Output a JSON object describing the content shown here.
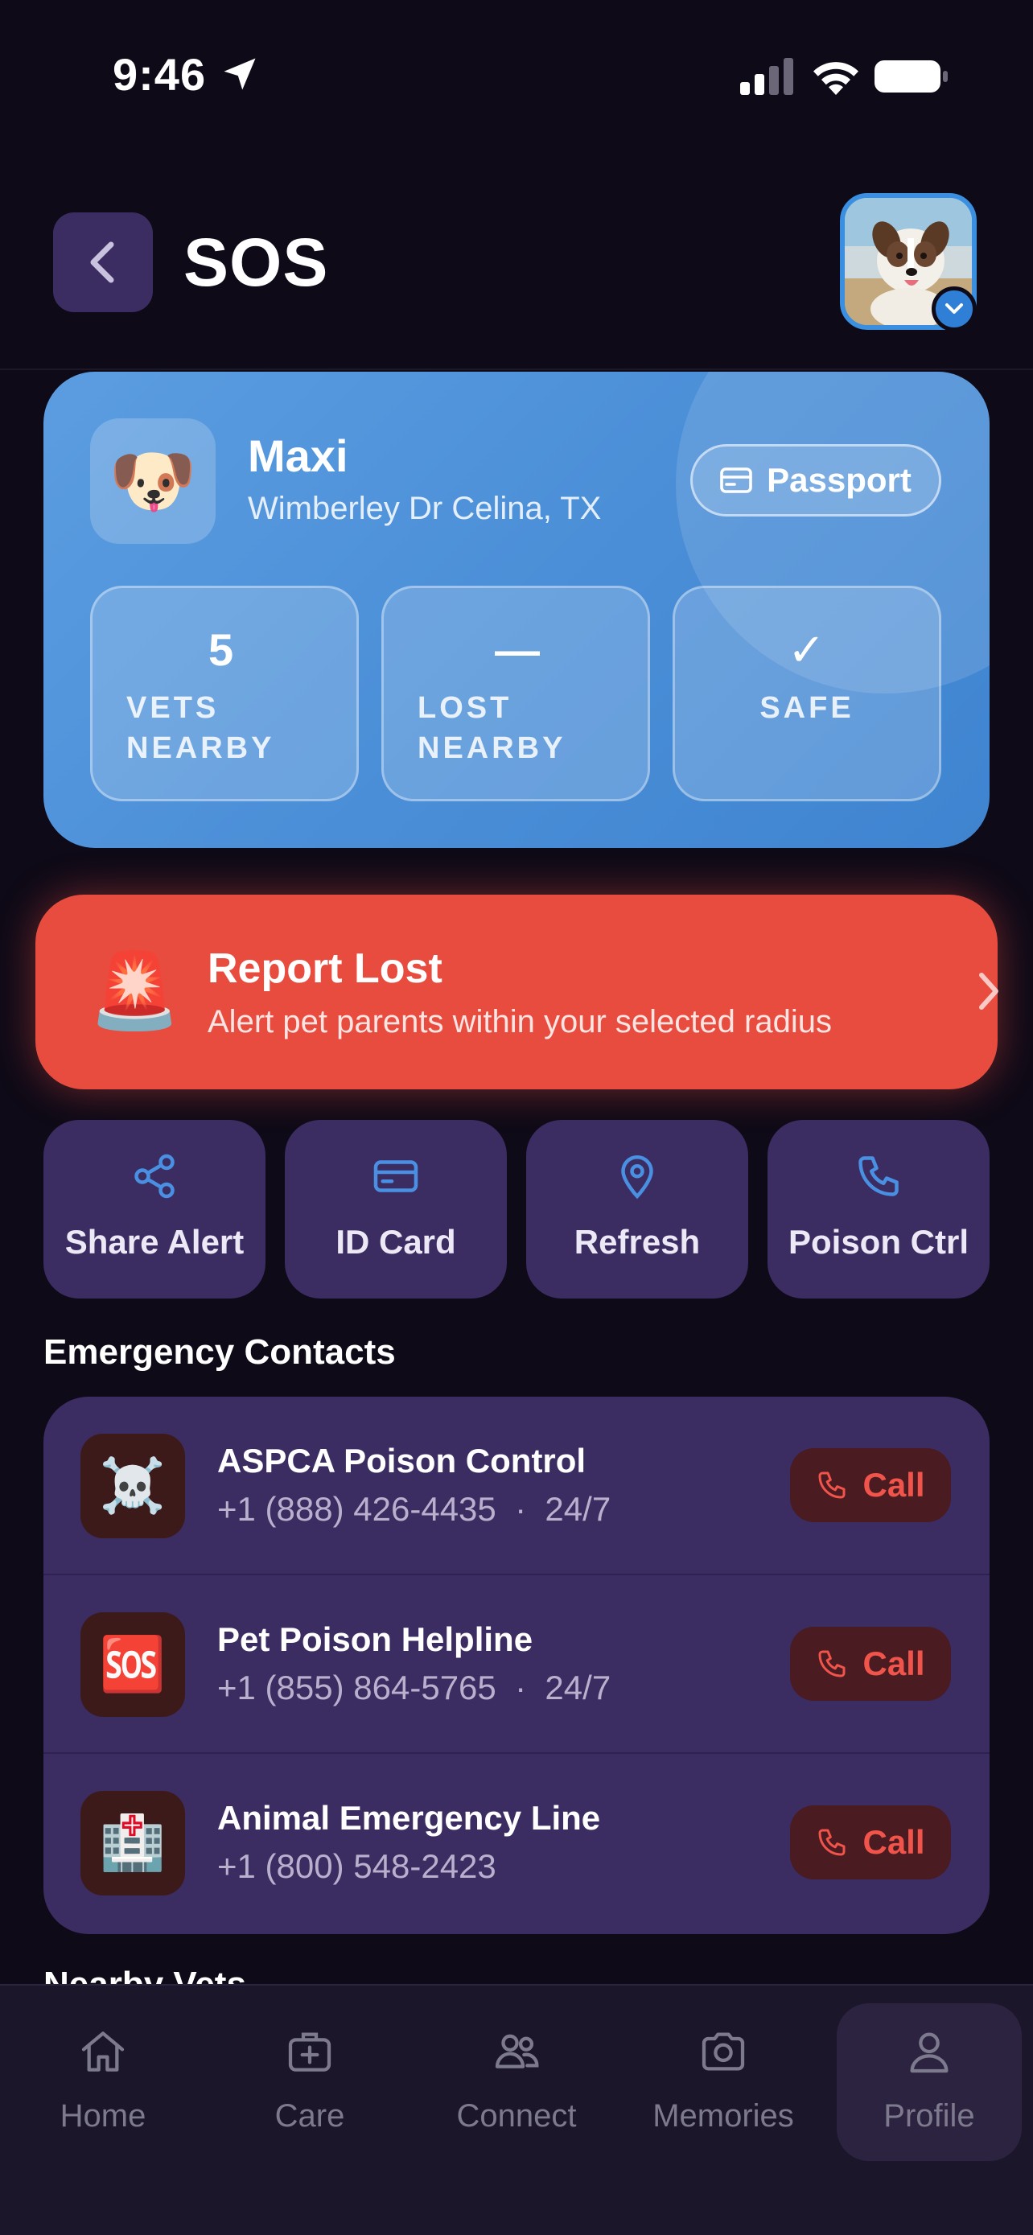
{
  "status_bar": {
    "time": "9:46"
  },
  "header": {
    "title": "SOS"
  },
  "pet": {
    "emoji": "🐶",
    "name": "Maxi",
    "address": "Wimberley Dr Celina, TX",
    "passport_label": "Passport",
    "stats": [
      {
        "value": "5",
        "label_line1": "VETS",
        "label_line2": "NEARBY"
      },
      {
        "value": "—",
        "label_line1": "LOST",
        "label_line2": "NEARBY"
      },
      {
        "value": "✓",
        "label_line1": "SAFE",
        "label_line2": ""
      }
    ]
  },
  "report_lost": {
    "icon": "🚨",
    "title": "Report Lost",
    "subtitle": "Alert pet parents within your selected radius"
  },
  "quick_actions": [
    {
      "label": "Share Alert",
      "icon": "share-icon"
    },
    {
      "label": "ID Card",
      "icon": "id-card-icon"
    },
    {
      "label": "Refresh",
      "icon": "location-pin-icon"
    },
    {
      "label": "Poison Ctrl",
      "icon": "phone-icon"
    }
  ],
  "emergency_contacts": {
    "title": "Emergency Contacts",
    "items": [
      {
        "icon": "☠️",
        "name": "ASPCA Poison Control",
        "phone": "+1 (888) 426-4435",
        "hours": "24/7",
        "sub": "+1 (888) 426-4435  ·  24/7",
        "call_label": "Call"
      },
      {
        "icon": "🆘",
        "name": "Pet Poison Helpline",
        "phone": "+1 (855) 864-5765",
        "hours": "24/7",
        "sub": "+1 (855) 864-5765  ·  24/7",
        "call_label": "Call"
      },
      {
        "icon": "🏥",
        "name": "Animal Emergency Line",
        "phone": "+1 (800) 548-2423",
        "hours": "",
        "sub": "+1 (800) 548-2423",
        "call_label": "Call"
      }
    ]
  },
  "nearby_vets": {
    "title": "Nearby Vets"
  },
  "tab_bar": {
    "active": "Profile",
    "tabs": [
      {
        "label": "Home",
        "icon": "home-icon"
      },
      {
        "label": "Care",
        "icon": "care-kit-icon"
      },
      {
        "label": "Connect",
        "icon": "people-icon"
      },
      {
        "label": "Memories",
        "icon": "camera-icon"
      },
      {
        "label": "Profile",
        "icon": "person-icon"
      }
    ]
  },
  "colors": {
    "background": "#0e0a17",
    "card_purple": "#3b2c62",
    "pet_card_blue": "#4b8fd8",
    "report_red": "#e84c3f",
    "call_red": "#f0544a",
    "icon_blue": "#4a90e2"
  }
}
